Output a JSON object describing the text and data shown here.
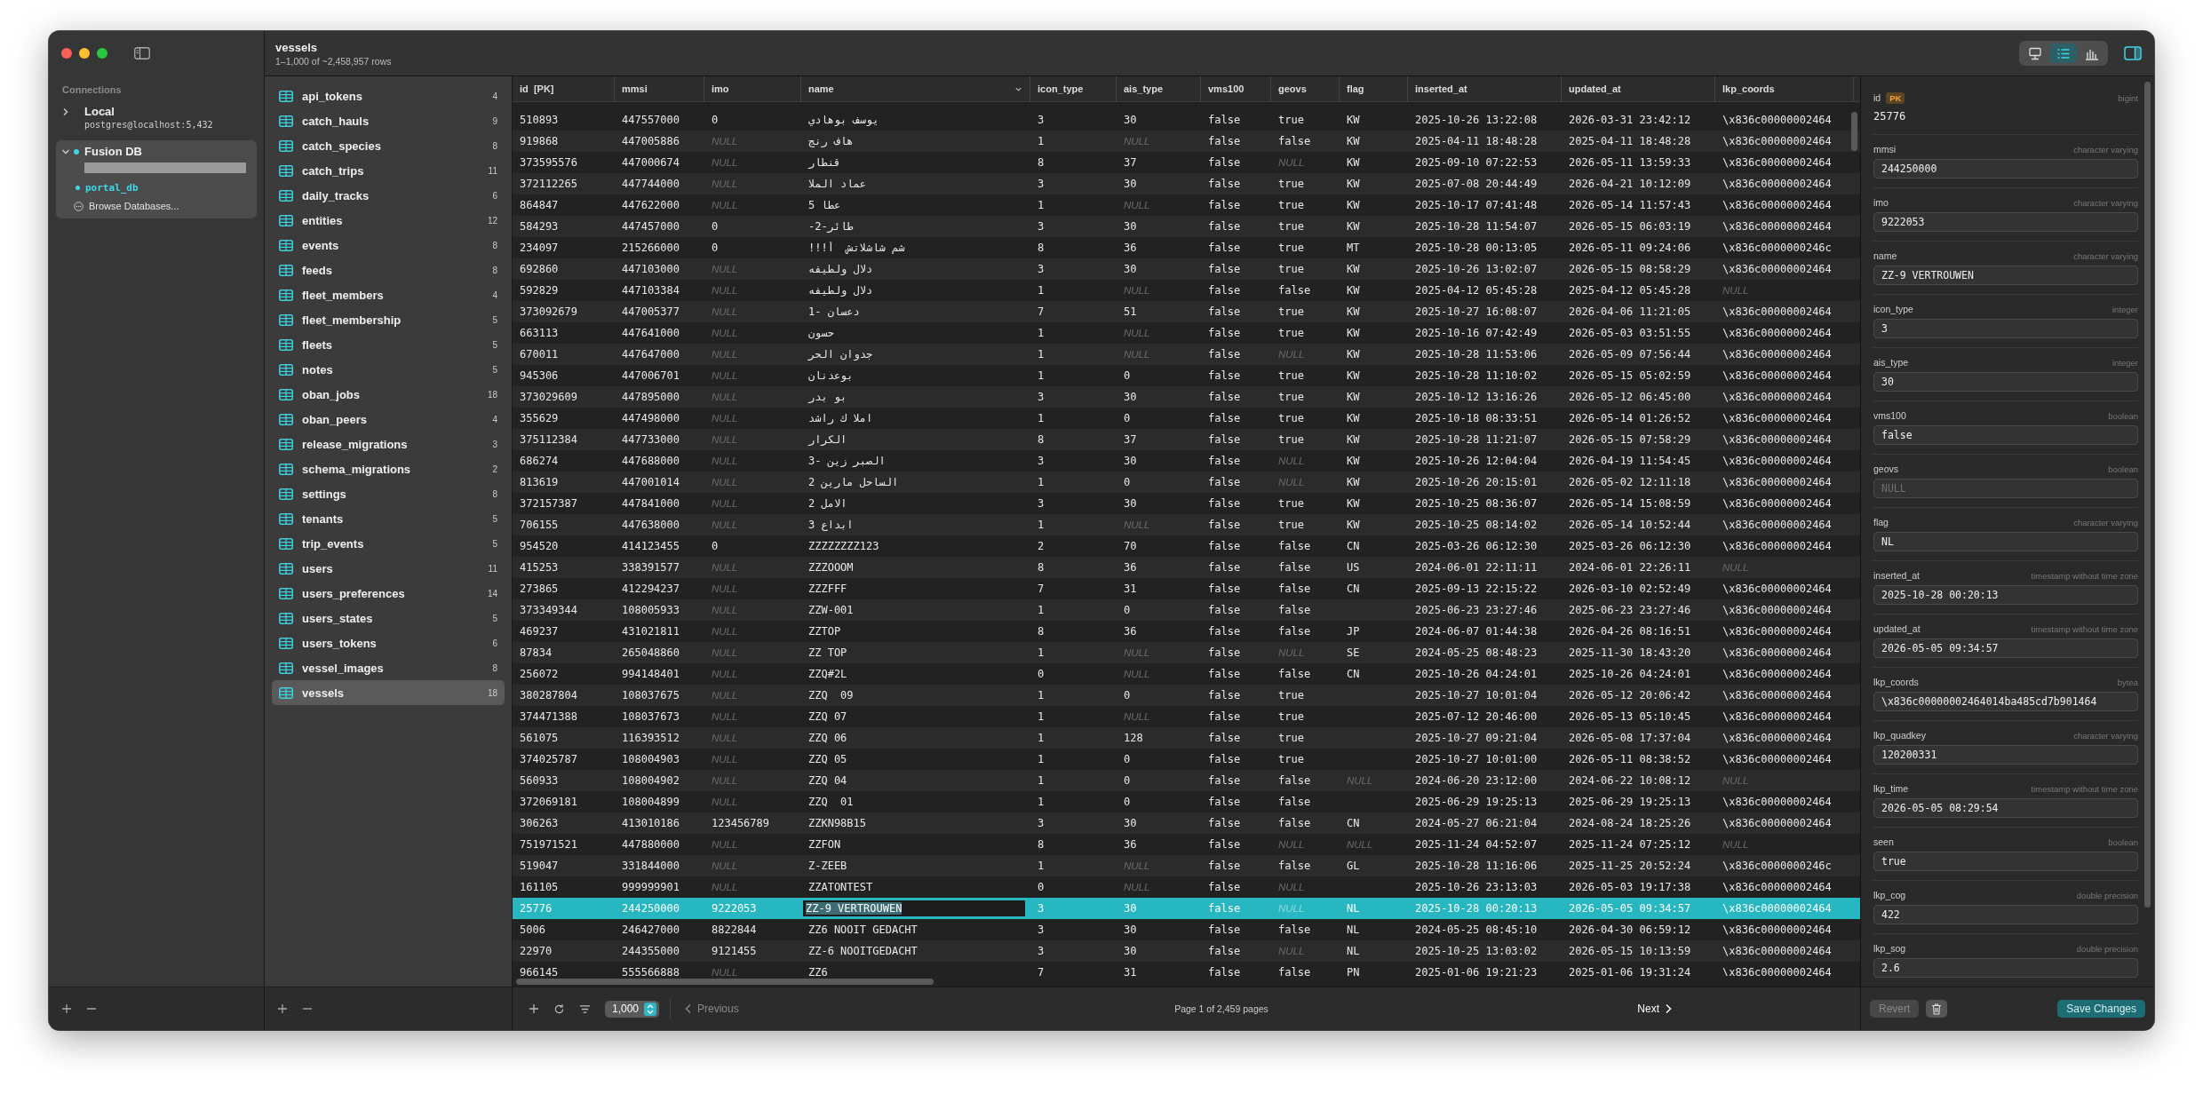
{
  "sidebar": {
    "section_title": "Connections",
    "connections": [
      {
        "name": "Local",
        "detail": "postgres@localhost:5,432",
        "detail_hidden": false,
        "expanded": false,
        "connected": false
      },
      {
        "name": "Fusion DB",
        "detail_hidden": true,
        "expanded": true,
        "connected": true,
        "databases": [
          {
            "name": "portal_db",
            "selected": true
          }
        ],
        "browse_label": "Browse Databases..."
      }
    ]
  },
  "tables": {
    "items": [
      {
        "name": "api_tokens",
        "columns": "4",
        "selected": false
      },
      {
        "name": "catch_hauls",
        "columns": "9",
        "selected": false
      },
      {
        "name": "catch_species",
        "columns": "8",
        "selected": false
      },
      {
        "name": "catch_trips",
        "columns": "11",
        "selected": false
      },
      {
        "name": "daily_tracks",
        "columns": "6",
        "selected": false
      },
      {
        "name": "entities",
        "columns": "12",
        "selected": false
      },
      {
        "name": "events",
        "columns": "8",
        "selected": false
      },
      {
        "name": "feeds",
        "columns": "8",
        "selected": false
      },
      {
        "name": "fleet_members",
        "columns": "4",
        "selected": false
      },
      {
        "name": "fleet_membership",
        "columns": "5",
        "selected": false
      },
      {
        "name": "fleets",
        "columns": "5",
        "selected": false
      },
      {
        "name": "notes",
        "columns": "5",
        "selected": false
      },
      {
        "name": "oban_jobs",
        "columns": "18",
        "selected": false
      },
      {
        "name": "oban_peers",
        "columns": "4",
        "selected": false
      },
      {
        "name": "release_migrations",
        "columns": "3",
        "selected": false
      },
      {
        "name": "schema_migrations",
        "columns": "2",
        "selected": false
      },
      {
        "name": "settings",
        "columns": "8",
        "selected": false
      },
      {
        "name": "tenants",
        "columns": "5",
        "selected": false
      },
      {
        "name": "trip_events",
        "columns": "5",
        "selected": false
      },
      {
        "name": "users",
        "columns": "11",
        "selected": false
      },
      {
        "name": "users_preferences",
        "columns": "14",
        "selected": false
      },
      {
        "name": "users_states",
        "columns": "5",
        "selected": false
      },
      {
        "name": "users_tokens",
        "columns": "6",
        "selected": false
      },
      {
        "name": "vessel_images",
        "columns": "8",
        "selected": false
      },
      {
        "name": "vessels",
        "columns": "18",
        "selected": true
      }
    ]
  },
  "header": {
    "title": "vessels",
    "subtitle": "1–1,000 of ~2,458,957 rows",
    "view_modes": [
      {
        "kind": "structure",
        "selected": false
      },
      {
        "kind": "data",
        "selected": true
      },
      {
        "kind": "chart",
        "selected": false
      }
    ],
    "inspector_toggle": {
      "on": true
    }
  },
  "grid": {
    "columns": [
      {
        "label": "id  [PK]",
        "sorted": false
      },
      {
        "label": "mmsi",
        "sorted": false
      },
      {
        "label": "imo",
        "sorted": false
      },
      {
        "label": "name",
        "sorted": true
      },
      {
        "label": "icon_type",
        "sorted": false
      },
      {
        "label": "ais_type",
        "sorted": false
      },
      {
        "label": "vms100",
        "sorted": false
      },
      {
        "label": "geovs",
        "sorted": false
      },
      {
        "label": "flag",
        "sorted": false
      },
      {
        "label": "inserted_at",
        "sorted": false
      },
      {
        "label": "updated_at",
        "sorted": false
      },
      {
        "label": "lkp_coords",
        "sorted": false
      }
    ],
    "rows": [
      {
        "selected": false,
        "cells": [
          "510893",
          "447557000",
          "0",
          "يوسف بوهادي",
          "3",
          "30",
          "false",
          "true",
          "KW",
          "2025-10-26 13:22:08",
          "2026-03-31 23:42:12",
          "\\x836c00000002464"
        ]
      },
      {
        "selected": false,
        "cells": [
          "919868",
          "447005886",
          {
            "kind": "null",
            "text": "NULL"
          },
          "هاف رنج",
          "1",
          {
            "kind": "null",
            "text": "NULL"
          },
          "false",
          "false",
          "KW",
          "2025-04-11 18:48:28",
          "2025-04-11 18:48:28",
          "\\x836c00000002464"
        ]
      },
      {
        "selected": false,
        "cells": [
          "373595576",
          "447000674",
          {
            "kind": "null",
            "text": "NULL"
          },
          "قنطار",
          "8",
          "37",
          "false",
          {
            "kind": "null",
            "text": "NULL"
          },
          "KW",
          "2025-09-10 07:22:53",
          "2026-05-11 13:59:33",
          "\\x836c00000002464"
        ]
      },
      {
        "selected": false,
        "cells": [
          "372112265",
          "447744000",
          {
            "kind": "null",
            "text": "NULL"
          },
          "عماد الملا",
          "3",
          "30",
          "false",
          "true",
          "KW",
          "2025-07-08 20:44:49",
          "2026-04-21 10:12:09",
          "\\x836c00000002464"
        ]
      },
      {
        "selected": false,
        "cells": [
          "864847",
          "447622000",
          {
            "kind": "null",
            "text": "NULL"
          },
          "عطا 5",
          "1",
          {
            "kind": "null",
            "text": "NULL"
          },
          "false",
          "true",
          "KW",
          "2025-10-17 07:41:48",
          "2026-05-14 11:57:43",
          "\\x836c00000002464"
        ]
      },
      {
        "selected": false,
        "cells": [
          "584293",
          "447457000",
          "0",
          "طائر-2-",
          "3",
          "30",
          "false",
          "true",
          "KW",
          "2025-10-28 11:54:07",
          "2026-05-15 06:03:19",
          "\\x836c00000002464"
        ]
      },
      {
        "selected": false,
        "cells": [
          "234097",
          "215266000",
          "0",
          "شم شاشلاتش  أ!!!",
          "8",
          "36",
          "false",
          "true",
          "MT",
          "2025-10-28 00:13:05",
          "2026-05-11 09:24:06",
          "\\x836c0000000246c"
        ]
      },
      {
        "selected": false,
        "cells": [
          "692860",
          "447103000",
          {
            "kind": "null",
            "text": "NULL"
          },
          "دلال ولطيفه",
          "3",
          "30",
          "false",
          "true",
          "KW",
          "2025-10-26 13:02:07",
          "2026-05-15 08:58:29",
          "\\x836c00000002464"
        ]
      },
      {
        "selected": false,
        "cells": [
          "592829",
          "447103384",
          {
            "kind": "null",
            "text": "NULL"
          },
          "دلال ولطيفه",
          "1",
          {
            "kind": "null",
            "text": "NULL"
          },
          "false",
          "false",
          "KW",
          "2025-04-12 05:45:28",
          "2025-04-12 05:45:28",
          {
            "kind": "null",
            "text": "NULL"
          }
        ]
      },
      {
        "selected": false,
        "cells": [
          "373092679",
          "447005377",
          {
            "kind": "null",
            "text": "NULL"
          },
          "دعسان -1",
          "7",
          "51",
          "false",
          "true",
          "KW",
          "2025-10-27 16:08:07",
          "2026-04-06 11:21:05",
          "\\x836c00000002464"
        ]
      },
      {
        "selected": false,
        "cells": [
          "663113",
          "447641000",
          {
            "kind": "null",
            "text": "NULL"
          },
          "حسون",
          "1",
          {
            "kind": "null",
            "text": "NULL"
          },
          "false",
          "true",
          "KW",
          "2025-10-16 07:42:49",
          "2026-05-03 03:51:55",
          "\\x836c00000002464"
        ]
      },
      {
        "selected": false,
        "cells": [
          "670011",
          "447647000",
          {
            "kind": "null",
            "text": "NULL"
          },
          "جدوان الحر",
          "1",
          {
            "kind": "null",
            "text": "NULL"
          },
          "false",
          {
            "kind": "null",
            "text": "NULL"
          },
          "KW",
          "2025-10-28 11:53:06",
          "2026-05-09 07:56:44",
          "\\x836c00000002464"
        ]
      },
      {
        "selected": false,
        "cells": [
          "945306",
          "447006701",
          {
            "kind": "null",
            "text": "NULL"
          },
          "بوعدنان",
          "1",
          "0",
          "false",
          "true",
          "KW",
          "2025-10-28 11:10:02",
          "2026-05-15 05:02:59",
          "\\x836c00000002464"
        ]
      },
      {
        "selected": false,
        "cells": [
          "373029609",
          "447895000",
          {
            "kind": "null",
            "text": "NULL"
          },
          "بو بدر",
          "3",
          "30",
          "false",
          "true",
          "KW",
          "2025-10-12 13:16:26",
          "2026-05-12 06:45:00",
          "\\x836c00000002464"
        ]
      },
      {
        "selected": false,
        "cells": [
          "355629",
          "447498000",
          {
            "kind": "null",
            "text": "NULL"
          },
          "املا ك راشد",
          "1",
          "0",
          "false",
          "true",
          "KW",
          "2025-10-18 08:33:51",
          "2026-05-14 01:26:52",
          "\\x836c00000002464"
        ]
      },
      {
        "selected": false,
        "cells": [
          "375112384",
          "447733000",
          {
            "kind": "null",
            "text": "NULL"
          },
          "الكرار",
          "8",
          "37",
          "false",
          "true",
          "KW",
          "2025-10-28 11:21:07",
          "2026-05-15 07:58:29",
          "\\x836c00000002464"
        ]
      },
      {
        "selected": false,
        "cells": [
          "686274",
          "447688000",
          {
            "kind": "null",
            "text": "NULL"
          },
          "الصبر زين -3",
          "3",
          "30",
          "false",
          {
            "kind": "null",
            "text": "NULL"
          },
          "KW",
          "2025-10-26 12:04:04",
          "2026-04-19 11:54:45",
          "\\x836c00000002464"
        ]
      },
      {
        "selected": false,
        "cells": [
          "813619",
          "447001014",
          {
            "kind": "null",
            "text": "NULL"
          },
          "الساحل مارين 2",
          "1",
          "0",
          "false",
          {
            "kind": "null",
            "text": "NULL"
          },
          "KW",
          "2025-10-26 20:15:01",
          "2026-05-02 12:11:18",
          "\\x836c00000002464"
        ]
      },
      {
        "selected": false,
        "cells": [
          "372157387",
          "447841000",
          {
            "kind": "null",
            "text": "NULL"
          },
          "الامل 2",
          "3",
          "30",
          "false",
          "true",
          "KW",
          "2025-10-25 08:36:07",
          "2026-05-14 15:08:59",
          "\\x836c00000002464"
        ]
      },
      {
        "selected": false,
        "cells": [
          "706155",
          "447638000",
          {
            "kind": "null",
            "text": "NULL"
          },
          "ابداع 3",
          "1",
          {
            "kind": "null",
            "text": "NULL"
          },
          "false",
          "true",
          "KW",
          "2025-10-25 08:14:02",
          "2026-05-14 10:52:44",
          "\\x836c00000002464"
        ]
      },
      {
        "selected": false,
        "cells": [
          "954520",
          "414123455",
          "0",
          "ZZZZZZZZ123",
          "2",
          "70",
          "false",
          "false",
          "CN",
          "2025-03-26 06:12:30",
          "2025-03-26 06:12:30",
          "\\x836c00000002464"
        ]
      },
      {
        "selected": false,
        "cells": [
          "415253",
          "338391577",
          {
            "kind": "null",
            "text": "NULL"
          },
          "ZZZOOOM",
          "8",
          "36",
          "false",
          "false",
          "US",
          "2024-06-01 22:11:11",
          "2024-06-01 22:26:11",
          {
            "kind": "null",
            "text": "NULL"
          }
        ]
      },
      {
        "selected": false,
        "cells": [
          "273865",
          "412294237",
          {
            "kind": "null",
            "text": "NULL"
          },
          "ZZZFFF",
          "7",
          "31",
          "false",
          "false",
          "CN",
          "2025-09-13 22:15:22",
          "2026-03-10 02:52:49",
          "\\x836c00000002464"
        ]
      },
      {
        "selected": false,
        "cells": [
          "373349344",
          "108005933",
          {
            "kind": "null",
            "text": "NULL"
          },
          "ZZW-001",
          "1",
          "0",
          "false",
          "false",
          null,
          "2025-06-23 23:27:46",
          "2025-06-23 23:27:46",
          "\\x836c00000002464"
        ]
      },
      {
        "selected": false,
        "cells": [
          "469237",
          "431021811",
          {
            "kind": "null",
            "text": "NULL"
          },
          "ZZTOP",
          "8",
          "36",
          "false",
          "false",
          "JP",
          "2024-06-07 01:44:38",
          "2026-04-26 08:16:51",
          "\\x836c00000002464"
        ]
      },
      {
        "selected": false,
        "cells": [
          "87834",
          "265048860",
          {
            "kind": "null",
            "text": "NULL"
          },
          "ZZ TOP",
          "1",
          {
            "kind": "null",
            "text": "NULL"
          },
          "false",
          {
            "kind": "null",
            "text": "NULL"
          },
          "SE",
          "2024-05-25 08:48:23",
          "2025-11-30 18:43:20",
          "\\x836c00000002464"
        ]
      },
      {
        "selected": false,
        "cells": [
          "256072",
          "994148401",
          {
            "kind": "null",
            "text": "NULL"
          },
          "ZZQ#2L",
          "0",
          {
            "kind": "null",
            "text": "NULL"
          },
          "false",
          "false",
          "CN",
          "2025-10-26 04:24:01",
          "2025-10-26 04:24:01",
          "\\x836c00000002464"
        ]
      },
      {
        "selected": false,
        "cells": [
          "380287804",
          "108037675",
          {
            "kind": "null",
            "text": "NULL"
          },
          "ZZQ  09",
          "1",
          "0",
          "false",
          "true",
          null,
          "2025-10-27 10:01:04",
          "2026-05-12 20:06:42",
          "\\x836c00000002464"
        ]
      },
      {
        "selected": false,
        "cells": [
          "374471388",
          "108037673",
          {
            "kind": "null",
            "text": "NULL"
          },
          "ZZQ 07",
          "1",
          {
            "kind": "null",
            "text": "NULL"
          },
          "false",
          "true",
          null,
          "2025-07-12 20:46:00",
          "2026-05-13 05:10:45",
          "\\x836c00000002464"
        ]
      },
      {
        "selected": false,
        "cells": [
          "561075",
          "116393512",
          {
            "kind": "null",
            "text": "NULL"
          },
          "ZZQ 06",
          "1",
          "128",
          "false",
          "true",
          null,
          "2025-10-27 09:21:04",
          "2026-05-08 17:37:04",
          "\\x836c00000002464"
        ]
      },
      {
        "selected": false,
        "cells": [
          "374025787",
          "108004903",
          {
            "kind": "null",
            "text": "NULL"
          },
          "ZZQ 05",
          "1",
          "0",
          "false",
          "true",
          null,
          "2025-10-27 10:01:00",
          "2026-05-11 08:38:52",
          "\\x836c00000002464"
        ]
      },
      {
        "selected": false,
        "cells": [
          "560933",
          "108004902",
          {
            "kind": "null",
            "text": "NULL"
          },
          "ZZQ 04",
          "1",
          "0",
          "false",
          "false",
          {
            "kind": "null",
            "text": "NULL"
          },
          "2024-06-20 23:12:00",
          "2024-06-22 10:08:12",
          {
            "kind": "null",
            "text": "NULL"
          }
        ]
      },
      {
        "selected": false,
        "cells": [
          "372069181",
          "108004899",
          {
            "kind": "null",
            "text": "NULL"
          },
          "ZZQ  01",
          "1",
          "0",
          "false",
          "false",
          null,
          "2025-06-29 19:25:13",
          "2025-06-29 19:25:13",
          "\\x836c00000002464"
        ]
      },
      {
        "selected": false,
        "cells": [
          "306263",
          "413010186",
          "123456789",
          "ZZKN98B15",
          "3",
          "30",
          "false",
          "false",
          "CN",
          "2024-05-27 06:21:04",
          "2024-08-24 18:25:26",
          "\\x836c00000002464"
        ]
      },
      {
        "selected": false,
        "cells": [
          "751971521",
          "447880000",
          {
            "kind": "null",
            "text": "NULL"
          },
          "ZZFON",
          "8",
          "36",
          "false",
          {
            "kind": "null",
            "text": "NULL"
          },
          {
            "kind": "null",
            "text": "NULL"
          },
          "2025-11-24 04:52:07",
          "2025-11-24 07:25:12",
          {
            "kind": "null",
            "text": "NULL"
          }
        ]
      },
      {
        "selected": false,
        "cells": [
          "519047",
          "331844000",
          {
            "kind": "null",
            "text": "NULL"
          },
          "Z-ZEEB",
          "1",
          {
            "kind": "null",
            "text": "NULL"
          },
          "false",
          "false",
          "GL",
          "2025-10-28 11:16:06",
          "2025-11-25 20:52:24",
          "\\x836c0000000246c"
        ]
      },
      {
        "selected": false,
        "cells": [
          "161105",
          "999999901",
          {
            "kind": "null",
            "text": "NULL"
          },
          "ZZATONTEST",
          "0",
          {
            "kind": "null",
            "text": "NULL"
          },
          "false",
          {
            "kind": "null",
            "text": "NULL"
          },
          null,
          "2025-10-26 23:13:03",
          "2026-05-03 19:17:38",
          "\\x836c00000002464"
        ]
      },
      {
        "selected": true,
        "cells": [
          "25776",
          "244250000",
          "9222053",
          {
            "kind": "editing",
            "text": "ZZ-9 VERTROUWEN"
          },
          "3",
          "30",
          "false",
          {
            "kind": "null",
            "text": "NULL"
          },
          "NL",
          "2025-10-28 00:20:13",
          "2026-05-05 09:34:57",
          "\\x836c00000002464"
        ]
      },
      {
        "selected": false,
        "cells": [
          "5006",
          "246427000",
          "8822844",
          "ZZ6 NOOIT GEDACHT",
          "3",
          "30",
          "false",
          "false",
          "NL",
          "2024-05-25 08:45:10",
          "2026-04-30 06:59:12",
          "\\x836c00000002464"
        ]
      },
      {
        "selected": false,
        "cells": [
          "22970",
          "244355000",
          "9121455",
          "ZZ-6 NOOITGEDACHT",
          "3",
          "30",
          "false",
          {
            "kind": "null",
            "text": "NULL"
          },
          "NL",
          "2025-10-25 13:03:02",
          "2026-05-15 10:13:59",
          "\\x836c00000002464"
        ]
      },
      {
        "selected": false,
        "cells": [
          "966145",
          "555566888",
          {
            "kind": "null",
            "text": "NULL"
          },
          "ZZ6",
          "7",
          "31",
          "false",
          "false",
          "PN",
          "2025-01-06 19:21:23",
          "2025-01-06 19:31:24",
          "\\x836c00000002464"
        ]
      }
    ]
  },
  "pagination": {
    "page_size": "1,000",
    "previous": "Previous",
    "previous_disabled": true,
    "page_info": "Page 1 of 2,459 pages",
    "next": "Next"
  },
  "inspector": {
    "fields": [
      {
        "name": "id",
        "badge": "PK",
        "type": "bigint",
        "value": "25776",
        "kind": "readonly"
      },
      {
        "name": "mmsi",
        "type": "character varying",
        "value": "244250000",
        "kind": "input"
      },
      {
        "name": "imo",
        "type": "character varying",
        "value": "9222053",
        "kind": "input"
      },
      {
        "name": "name",
        "type": "character varying",
        "value": "ZZ-9 VERTROUWEN",
        "kind": "input"
      },
      {
        "name": "icon_type",
        "type": "integer",
        "value": "3",
        "kind": "input"
      },
      {
        "name": "ais_type",
        "type": "integer",
        "value": "30",
        "kind": "input"
      },
      {
        "name": "vms100",
        "type": "boolean",
        "value": "false",
        "kind": "input"
      },
      {
        "name": "geovs",
        "type": "boolean",
        "placeholder": "NULL",
        "kind": "null"
      },
      {
        "name": "flag",
        "type": "character varying",
        "value": "NL",
        "kind": "input"
      },
      {
        "name": "inserted_at",
        "type": "timestamp without time zone",
        "value": "2025-10-28 00:20:13",
        "kind": "input"
      },
      {
        "name": "updated_at",
        "type": "timestamp without time zone",
        "value": "2026-05-05 09:34:57",
        "kind": "input"
      },
      {
        "name": "lkp_coords",
        "type": "bytea",
        "value": "\\x836c00000002464014ba485cd7b901464",
        "kind": "input"
      },
      {
        "name": "lkp_quadkey",
        "type": "character varying",
        "value": "120200331",
        "kind": "input"
      },
      {
        "name": "lkp_time",
        "type": "timestamp without time zone",
        "value": "2026-05-05 08:29:54",
        "kind": "input"
      },
      {
        "name": "seen",
        "type": "boolean",
        "value": "true",
        "kind": "input"
      },
      {
        "name": "lkp_cog",
        "type": "double precision",
        "value": "422",
        "kind": "input"
      },
      {
        "name": "lkp_sog",
        "type": "double precision",
        "value": "2.6",
        "kind": "input"
      }
    ],
    "revert": "Revert",
    "revert_disabled": true,
    "save": "Save Changes"
  }
}
